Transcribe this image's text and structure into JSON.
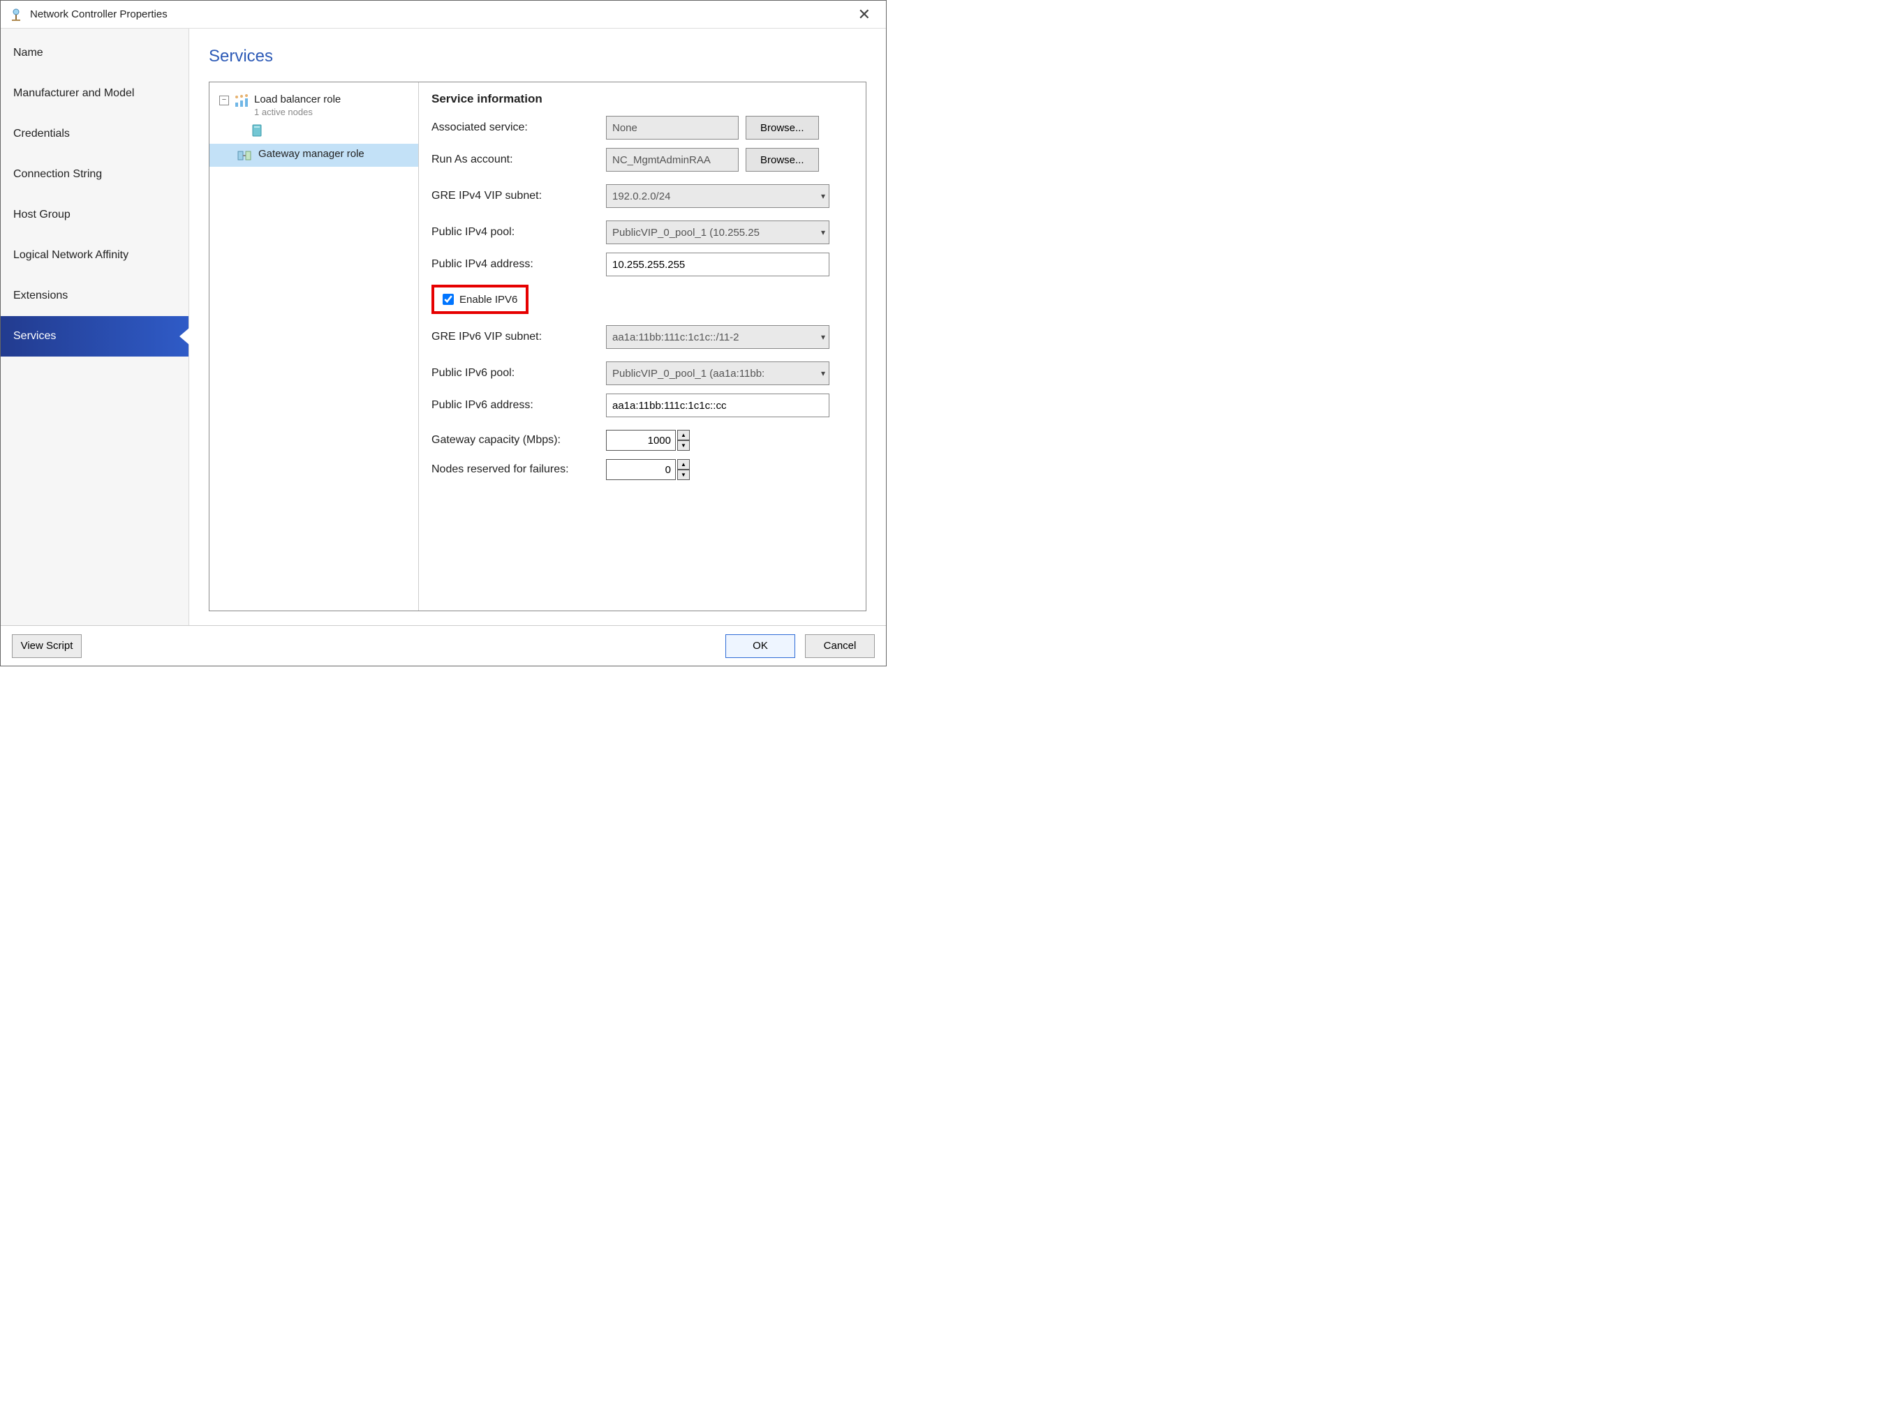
{
  "window": {
    "title": "Network Controller Properties"
  },
  "sidebar": {
    "items": [
      {
        "label": "Name"
      },
      {
        "label": "Manufacturer and Model"
      },
      {
        "label": "Credentials"
      },
      {
        "label": "Connection String"
      },
      {
        "label": "Host Group"
      },
      {
        "label": "Logical Network Affinity"
      },
      {
        "label": "Extensions"
      },
      {
        "label": "Services",
        "selected": true
      }
    ]
  },
  "main": {
    "title": "Services",
    "tree": {
      "expando_glyph": "−",
      "role1": {
        "label": "Load balancer role",
        "sub": "1 active nodes"
      },
      "role2": {
        "label": "Gateway manager role"
      }
    },
    "form": {
      "section_title": "Service information",
      "associated_service": {
        "label": "Associated service:",
        "value": "None",
        "browse": "Browse..."
      },
      "run_as": {
        "label": "Run As account:",
        "value": "NC_MgmtAdminRAA",
        "browse": "Browse..."
      },
      "gre_v4": {
        "label": "GRE IPv4 VIP subnet:",
        "value": "192.0.2.0/24"
      },
      "pub_v4_pool": {
        "label": "Public IPv4 pool:",
        "value": "PublicVIP_0_pool_1 (10.255.25"
      },
      "pub_v4_addr": {
        "label": "Public IPv4 address:",
        "value": "10.255.255.255"
      },
      "enable_ipv6": {
        "label": "Enable IPV6",
        "checked": true
      },
      "gre_v6": {
        "label": "GRE IPv6 VIP subnet:",
        "value": "aa1a:11bb:111c:1c1c::/11-2"
      },
      "pub_v6_pool": {
        "label": "Public IPv6 pool:",
        "value": "PublicVIP_0_pool_1 (aa1a:11bb:"
      },
      "pub_v6_addr": {
        "label": "Public IPv6 address:",
        "value": "aa1a:11bb:111c:1c1c::cc"
      },
      "capacity": {
        "label": "Gateway capacity (Mbps):",
        "value": "1000"
      },
      "reserved": {
        "label": "Nodes reserved for failures:",
        "value": "0"
      }
    }
  },
  "footer": {
    "view_script": "View Script",
    "ok": "OK",
    "cancel": "Cancel"
  }
}
